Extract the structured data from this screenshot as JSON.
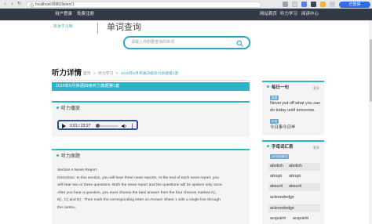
{
  "browser": {
    "url": "localhost:8080/listen/1",
    "pause_label": "已暂停"
  },
  "topnav": {
    "links": [
      "用户登录",
      "免费注册"
    ],
    "right_links": [
      "网站首页",
      "听力学习",
      "阅读中心"
    ]
  },
  "header": {
    "logo_text": "英语学习网",
    "dict_title": "单词查询",
    "search_placeholder": "请输入你想要查询的单词"
  },
  "page": {
    "title": "听力详情",
    "breadcrumb": [
      "首页",
      ">",
      "听力学习",
      ">",
      "2019年6月英语四级听力真题第1套"
    ],
    "banner": "2019年6月英语四级听力真题第1套"
  },
  "listen_section": {
    "heading": "听力播放",
    "time": "0:01 / 23:27"
  },
  "text_section": {
    "heading": "听力原题",
    "lines": [
      "Section A News Report",
      "Directions:   In this section,   you will hear three news reports.   At the end of each news report,   you",
      "will hear two or three questions.   Both the news report and the questions will be spoken only once.",
      "After you hear a question,   you must choose the best answer from the four choices marked A)   ,",
      "B)   ,   C)   and D)   .   Then mark the corresponding letter on Answer Sheet 1 with a single line through",
      "the centre。"
    ]
  },
  "daily_quote": {
    "title": "每日一句",
    "more": "更多",
    "tag_en": "英语",
    "text_en": "Never put off what you can do today until tomorrow.",
    "tag_zh": "中文",
    "text_zh": "今日事今日毕"
  },
  "vocab": {
    "title": "字母词汇表",
    "more": "更多",
    "tag": "a开头的单词",
    "words": [
      "abolish",
      "abolish",
      "abrupt",
      "abrupt",
      "absurd",
      "absurd",
      "acknowledge",
      "acknowledge",
      "acquaint",
      "acquaint"
    ]
  },
  "colors": {
    "accent": "#2fb3c7",
    "nav_bg": "#323a47",
    "player_border": "#2b4f9b"
  }
}
